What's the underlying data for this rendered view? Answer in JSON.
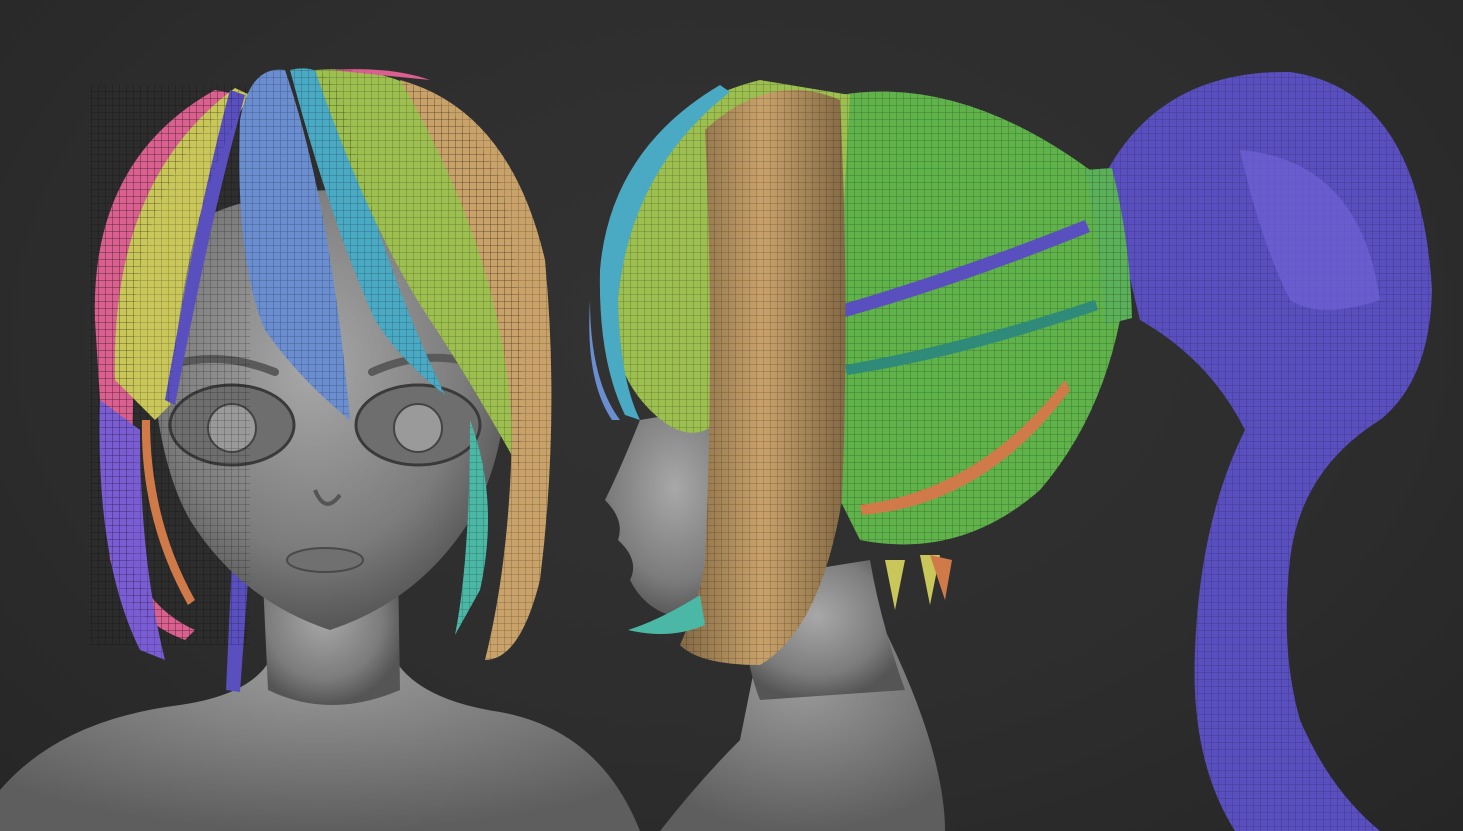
{
  "scene": {
    "background_color": "#2d2d2d",
    "skin_color": "#8a8a8a",
    "hair_colors": {
      "pink": "#d9608f",
      "yellow": "#c9c65a",
      "blue": "#6a8ecf",
      "cyan": "#4aa9c3",
      "lime": "#9cbf4f",
      "tan": "#c9a26a",
      "purple": "#5a4fbf",
      "green": "#5fb34a",
      "teal": "#4bb8a6",
      "orange": "#d07a4a"
    },
    "views": [
      {
        "name": "front-view"
      },
      {
        "name": "side-view"
      }
    ]
  }
}
